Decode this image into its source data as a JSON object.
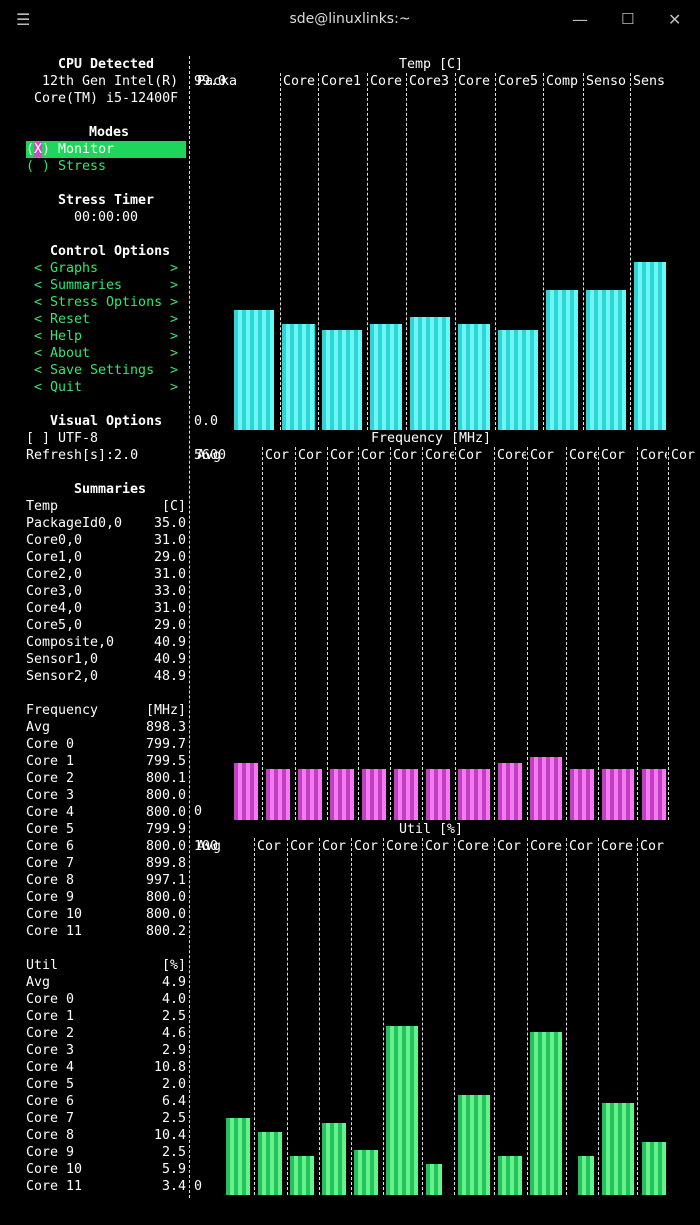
{
  "window": {
    "title": "sde@linuxlinks:~"
  },
  "sidebar": {
    "cpu_title": "CPU Detected",
    "cpu_line1": "12th Gen Intel(R)",
    "cpu_line2": "Core(TM) i5-12400F",
    "modes_title": "Modes",
    "mode_monitor_mark": "X",
    "mode_monitor": "Monitor",
    "mode_stress": "( ) Stress",
    "stress_timer_title": "Stress Timer",
    "stress_timer_value": "00:00:00",
    "control_title": "Control Options",
    "controls": [
      "Graphs",
      "Summaries",
      "Stress Options",
      "Reset",
      "Help",
      "About",
      "Save Settings",
      "Quit"
    ],
    "visual_title": "Visual Options",
    "utf8": "[ ] UTF-8",
    "refresh": "Refresh[s]:2.0",
    "summaries_title": "Summaries",
    "temp_header": [
      "Temp",
      "[C]"
    ],
    "temp_rows": [
      [
        "PackageId0,0",
        "35.0"
      ],
      [
        "Core0,0",
        "31.0"
      ],
      [
        "Core1,0",
        "29.0"
      ],
      [
        "Core2,0",
        "31.0"
      ],
      [
        "Core3,0",
        "33.0"
      ],
      [
        "Core4,0",
        "31.0"
      ],
      [
        "Core5,0",
        "29.0"
      ],
      [
        "Composite,0",
        "40.9"
      ],
      [
        "Sensor1,0",
        "40.9"
      ],
      [
        "Sensor2,0",
        "48.9"
      ]
    ],
    "freq_header": [
      "Frequency",
      "[MHz]"
    ],
    "freq_rows": [
      [
        "Avg",
        "898.3"
      ],
      [
        "Core 0",
        "799.7"
      ],
      [
        "Core 1",
        "799.5"
      ],
      [
        "Core 2",
        "800.1"
      ],
      [
        "Core 3",
        "800.0"
      ],
      [
        "Core 4",
        "800.0"
      ],
      [
        "Core 5",
        "799.9"
      ],
      [
        "Core 6",
        "800.0"
      ],
      [
        "Core 7",
        "899.8"
      ],
      [
        "Core 8",
        "997.1"
      ],
      [
        "Core 9",
        "800.0"
      ],
      [
        "Core 10",
        "800.0"
      ],
      [
        "Core 11",
        "800.2"
      ]
    ],
    "util_header": [
      "Util",
      "[%]"
    ],
    "util_rows": [
      [
        "Avg",
        "4.9"
      ],
      [
        "Core 0",
        "4.0"
      ],
      [
        "Core 1",
        "2.5"
      ],
      [
        "Core 2",
        "4.6"
      ],
      [
        "Core 3",
        "2.9"
      ],
      [
        "Core 4",
        "10.8"
      ],
      [
        "Core 5",
        "2.0"
      ],
      [
        "Core 6",
        "6.4"
      ],
      [
        "Core 7",
        "2.5"
      ],
      [
        "Core 8",
        "10.4"
      ],
      [
        "Core 9",
        "2.5"
      ],
      [
        "Core 10",
        "5.9"
      ],
      [
        "Core 11",
        "3.4"
      ]
    ]
  },
  "graphs": {
    "temp": {
      "title": "Temp [C]",
      "ymax": "99.0",
      "ymin": "0.0",
      "cols": [
        "Packa",
        "Core",
        "Core1",
        "Core",
        "Core3",
        "Core",
        "Core5",
        "Comp",
        "Senso",
        "Sens"
      ],
      "values": [
        35.0,
        31.0,
        29.0,
        31.0,
        33.0,
        31.0,
        29.0,
        40.9,
        40.9,
        48.9
      ]
    },
    "freq": {
      "title": "Frequency [MHz]",
      "ymax": "5600",
      "ymin": "0",
      "cols": [
        "Avg",
        "Cor",
        "Cor",
        "Cor",
        "Cor",
        "Cor",
        "Core",
        "Cor",
        "Core",
        "Cor",
        "Core",
        "Cor",
        "Core",
        "Cor"
      ],
      "values": [
        898.3,
        799.7,
        799.5,
        800.1,
        800.0,
        800.0,
        799.9,
        800.0,
        899.8,
        997.1,
        800.0,
        800.0,
        800.2
      ]
    },
    "util": {
      "title": "Util [%]",
      "ymax": "100",
      "ymin": "0",
      "cols": [
        "Avg",
        "Cor",
        "Cor",
        "Cor",
        "Cor",
        "Core",
        "Cor",
        "Core",
        "Cor",
        "Core",
        "Cor",
        "Core",
        "Cor"
      ],
      "values": [
        4.9,
        4.0,
        2.5,
        4.6,
        2.9,
        10.8,
        2.0,
        6.4,
        2.5,
        10.4,
        2.5,
        5.9,
        3.4
      ]
    }
  }
}
